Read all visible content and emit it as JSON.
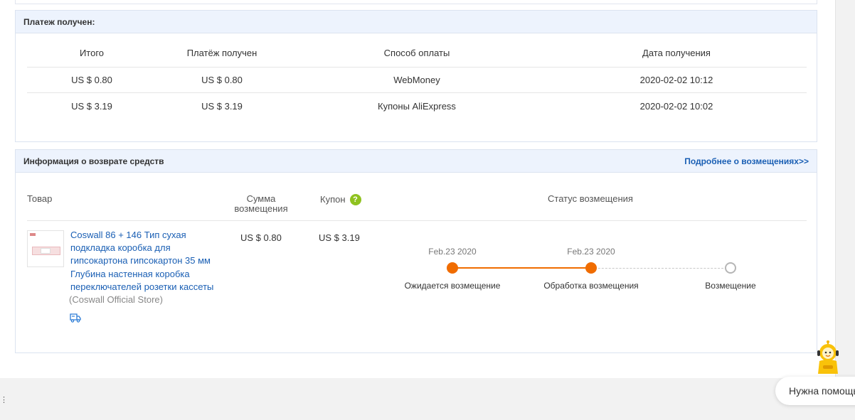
{
  "payment": {
    "title": "Платеж получен:",
    "columns": [
      "Итого",
      "Платёж получен",
      "Способ оплаты",
      "Дата получения"
    ],
    "rows": [
      [
        "US $ 0.80",
        "US $ 0.80",
        "WebMoney",
        "2020-02-02 10:12"
      ],
      [
        "US $ 3.19",
        "US $ 3.19",
        "Купоны AliExpress",
        "2020-02-02 10:02"
      ]
    ]
  },
  "refund": {
    "title": "Информация о возврате средств",
    "more_link": "Подробнее о возмещениях>>",
    "col_goods": "Товар",
    "col_sum": "Сумма возмещения",
    "col_coupon": "Купон",
    "help_glyph": "?",
    "col_status": "Статус возмещения",
    "item": {
      "title": "Coswall 86 + 146 Тип сухая подкладка коробка для гипсокартона гипсокартон 35 мм Глубина настенная коробка переключателей розетки кассеты",
      "store": "(Coswall Official Store)",
      "refund_amount": "US $ 0.80",
      "coupon_amount": "US $ 3.19"
    },
    "timeline": [
      {
        "date": "Feb.23 2020",
        "label": "Ожидается возмещение",
        "state": "done"
      },
      {
        "date": "Feb.23 2020",
        "label": "Обработка возмещения",
        "state": "done"
      },
      {
        "date": "",
        "label": "Возмещение",
        "state": "pending"
      }
    ]
  },
  "chat": {
    "bubble_text": "Нужна помощь?"
  },
  "colors": {
    "accent": "#f06c00",
    "link": "#1a5fb4",
    "header_bg": "#edf3fd",
    "help_icon": "#8fc21f"
  }
}
